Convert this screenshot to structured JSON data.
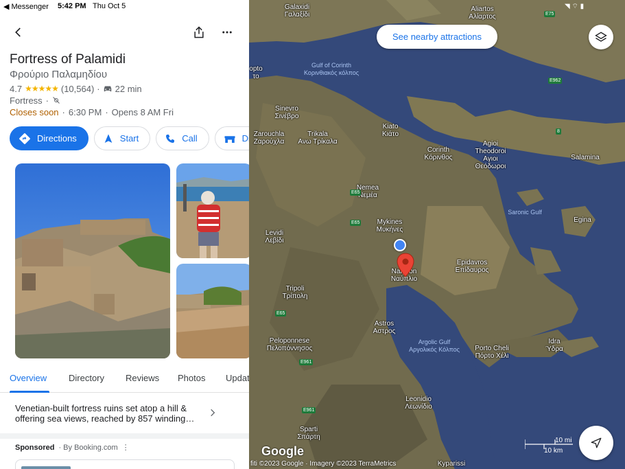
{
  "status_bar": {
    "back_app": "◀ Messenger",
    "time": "5:42 PM",
    "date": "Thu Oct 5"
  },
  "place": {
    "name": "Fortress of Palamidi",
    "name_local": "Φρούριο Παλαμηδίου",
    "rating": "4.7",
    "stars": 4.7,
    "reviews": "(10,564)",
    "drive_time": "22 min",
    "category": "Fortress",
    "status": "Closes soon",
    "close_time": "6:30 PM",
    "opens": "Opens 8 AM Fri",
    "separator": "·"
  },
  "actions": [
    {
      "label": "Directions",
      "icon": "directions-icon"
    },
    {
      "label": "Start",
      "icon": "navigation-arrow-icon"
    },
    {
      "label": "Call",
      "icon": "phone-icon"
    },
    {
      "label": "Dir",
      "icon": "hotel-icon"
    }
  ],
  "tabs": [
    "Overview",
    "Directory",
    "Reviews",
    "Photos",
    "Updat"
  ],
  "active_tab": "Overview",
  "description": "Venetian-built fortress ruins set atop a hill & offering sea views, reached by 857 winding…",
  "sponsored": {
    "label": "Sponsored",
    "by": "· By Booking.com",
    "more": "⋮"
  },
  "map": {
    "nearby_button": "See nearby attractions",
    "labels": [
      {
        "text": "Galaxidi\nΓαλαξίδι",
        "water": false
      },
      {
        "text": "Aliartos\nΑλίαρτος",
        "water": false
      },
      {
        "text": "Gulf of Corinth\nΚορινθιακός κόλπος",
        "water": true
      },
      {
        "text": "opto\nτο",
        "water": false
      },
      {
        "text": "Sinevro\nΣινέβρο",
        "water": false
      },
      {
        "text": "Zarouchla\nΖαρούχλα",
        "water": false
      },
      {
        "text": "Trikala\nΑνω Τρίκαλα",
        "water": false
      },
      {
        "text": "Kiato\nΚιάτο",
        "water": false
      },
      {
        "text": "Corinth\nΚόρινθος",
        "water": false
      },
      {
        "text": "Agioi\nTheodoroi\nΑγιοι\nΘεόδωροι",
        "water": false
      },
      {
        "text": "Salamina",
        "water": false
      },
      {
        "text": "Nemea\nΝεμέα",
        "water": false
      },
      {
        "text": "Saronic Gulf",
        "water": true
      },
      {
        "text": "Egina",
        "water": false
      },
      {
        "text": "Levidi\nΛεβίδι",
        "water": false
      },
      {
        "text": "Mykines\nΜυκήνες",
        "water": false
      },
      {
        "text": "Nafplion\nΝαύπλιο",
        "water": false
      },
      {
        "text": "Epidavros\nΕπίδαυρος",
        "water": false
      },
      {
        "text": "Tripoli\nΤρίπολη",
        "water": false
      },
      {
        "text": "Astros\nΑστρος",
        "water": false
      },
      {
        "text": "Argolic Gulf\nΑργολικός Κόλπος",
        "water": true
      },
      {
        "text": "Peloponnese\nΠελοπόννησος",
        "water": false
      },
      {
        "text": "Porto Cheli\nΠόρτο Χέλι",
        "water": false
      },
      {
        "text": "Idra\nΎδρα",
        "water": false
      },
      {
        "text": "Leonidio\nΛεωνίδιο",
        "water": false
      },
      {
        "text": "Sparti\nΣπάρτη",
        "water": false
      },
      {
        "text": "Kyparissi",
        "water": false
      }
    ],
    "roads": [
      "E75",
      "E962",
      "8",
      "E65",
      "E65",
      "E65",
      "E961",
      "E961"
    ],
    "google_logo": "Google",
    "attribution": "fiti ©2023 Google · Imagery ©2023 TerraMetrics",
    "scale_mi": "10 mi",
    "scale_km": "10 km"
  }
}
